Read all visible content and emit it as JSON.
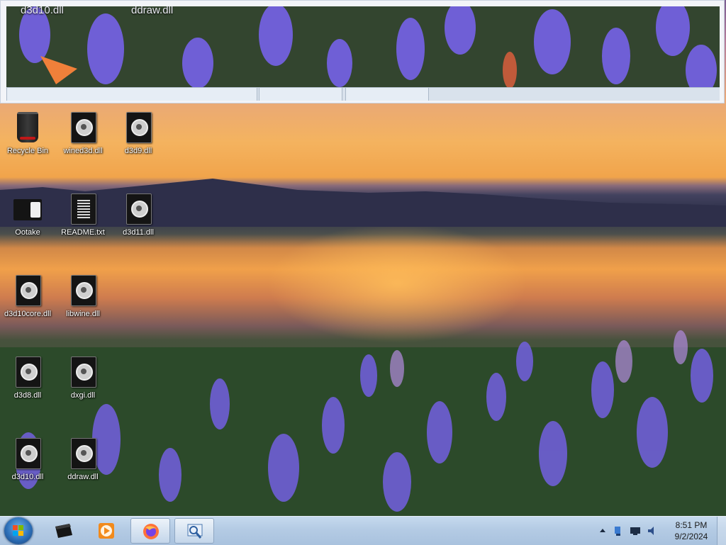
{
  "preview": {
    "labels": [
      "d3d10.dll",
      "ddraw.dll"
    ]
  },
  "desktop": {
    "icons": [
      {
        "label": "Recycle Bin"
      },
      {
        "label": "wined3d.dll"
      },
      {
        "label": "d3d9.dll"
      },
      {
        "label": "Ootake"
      },
      {
        "label": "README.txt"
      },
      {
        "label": "d3d11.dll"
      },
      {
        "label": "d3d10core.dll"
      },
      {
        "label": "libwine.dll"
      },
      {
        "label": "d3d8.dll"
      },
      {
        "label": "dxgi.dll"
      },
      {
        "label": "d3d10.dll"
      },
      {
        "label": "ddraw.dll"
      }
    ]
  },
  "taskbar": {
    "start_icon": "windows-start-icon",
    "items": [
      {
        "icon": "ootake-icon"
      },
      {
        "icon": "media-player-icon"
      },
      {
        "icon": "firefox-icon"
      },
      {
        "icon": "image-viewer-icon"
      }
    ],
    "tray": {
      "icons": [
        "show-hidden-icons-icon",
        "network-icon",
        "display-icon",
        "volume-icon"
      ],
      "time": "8:51 PM",
      "date": "9/2/2024"
    }
  },
  "colors": {
    "taskbar": "#b4cbe4",
    "sky_top": "#7b5d92",
    "sunset": "#f4b35f",
    "flowers": "#6a5acd"
  }
}
